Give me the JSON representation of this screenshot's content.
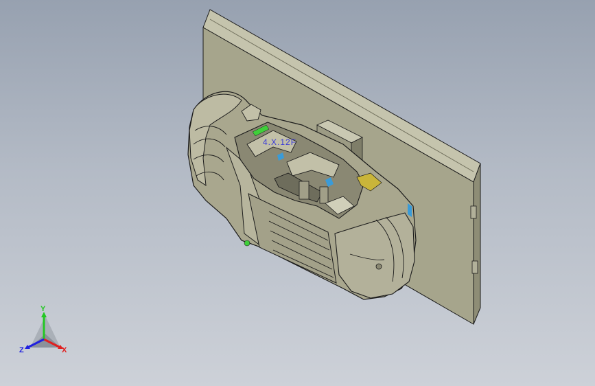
{
  "viewport": {
    "background_top": "#97a1b0",
    "background_bottom": "#cdd1d8"
  },
  "model": {
    "body_color": "#a9a78e",
    "plate_color": "#a5a48b",
    "edge_color": "#1b1b1b",
    "highlight_green": "#3fcf3a",
    "highlight_yellow": "#c9b53a",
    "highlight_blue": "#3a9bd8"
  },
  "annotation": {
    "text": "4.X.12F"
  },
  "triad": {
    "y_label": "Y",
    "x_label": "X",
    "z_label": "Z",
    "y_color": "#22c822",
    "x_color": "#e02020",
    "z_color": "#2020e0"
  }
}
